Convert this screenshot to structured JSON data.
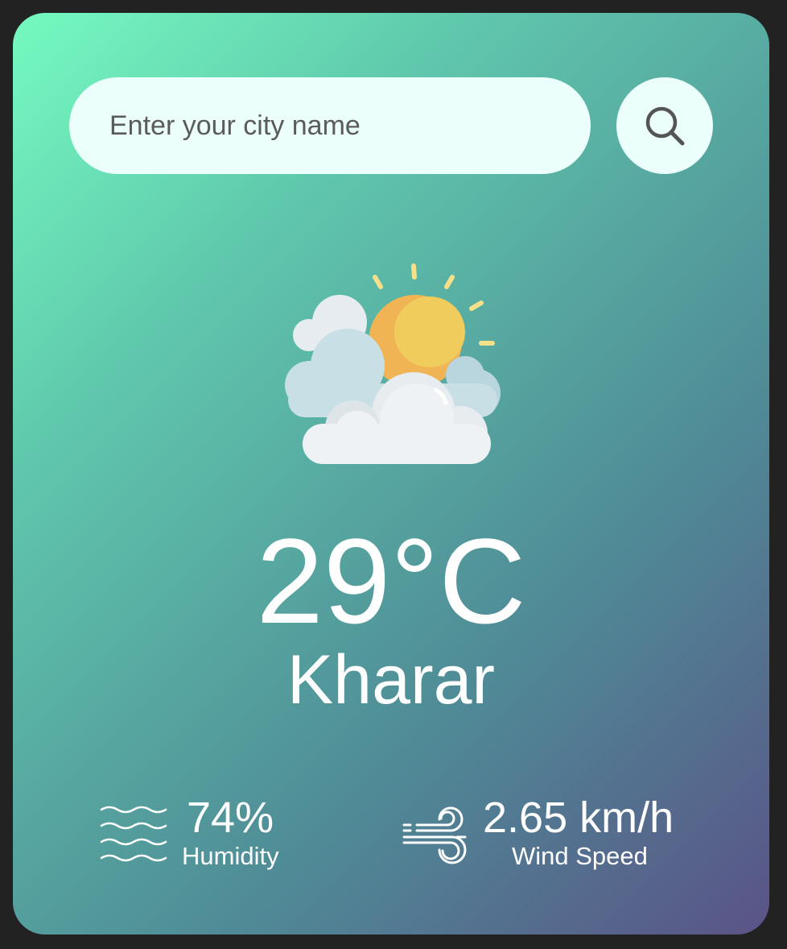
{
  "search": {
    "placeholder": "Enter your city name",
    "value": "",
    "button_icon": "search-icon"
  },
  "weather": {
    "icon": "partly-cloudy-icon",
    "temperature": "29°C",
    "city": "Kharar"
  },
  "details": {
    "humidity": {
      "icon": "humidity-waves-icon",
      "value": "74%",
      "label": "Humidity"
    },
    "wind": {
      "icon": "wind-icon",
      "value": "2.65 km/h",
      "label": "Wind Speed"
    }
  },
  "colors": {
    "background": "#222222",
    "gradient_start": "#75fac0",
    "gradient_end": "#5a5387",
    "search_field": "#ebfffb",
    "text": "#ffffff"
  }
}
